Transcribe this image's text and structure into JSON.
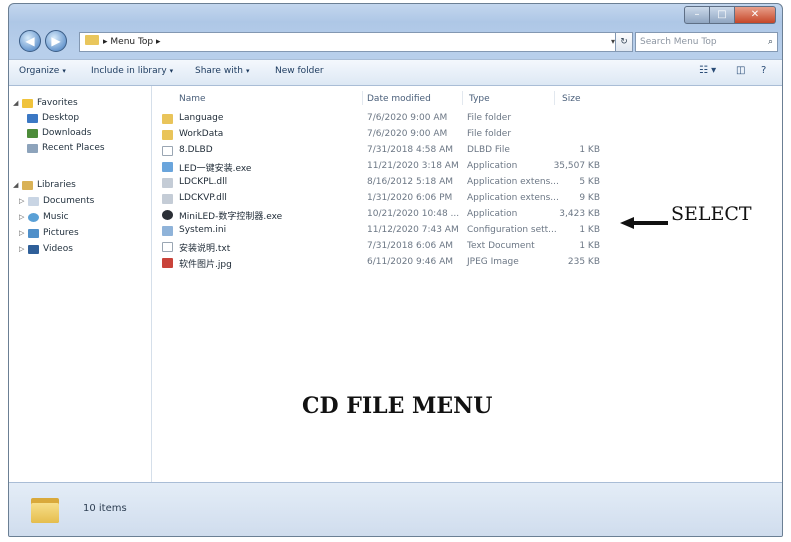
{
  "window": {
    "caption_buttons": [
      "minimize",
      "maximize",
      "close"
    ],
    "address_path": "Menu Top",
    "search_placeholder": "Search Menu Top"
  },
  "toolbar": {
    "organize": "Organize",
    "include_in_library": "Include in library",
    "share_with": "Share with",
    "new_folder": "New folder"
  },
  "navigation": {
    "favorites": "Favorites",
    "desktop": "Desktop",
    "downloads": "Downloads",
    "recent_places": "Recent Places",
    "libraries": "Libraries",
    "documents": "Documents",
    "music": "Music",
    "pictures": "Pictures",
    "videos": "Videos"
  },
  "columns": {
    "name": "Name",
    "date_modified": "Date modified",
    "type": "Type",
    "size": "Size"
  },
  "files": [
    {
      "name": "Language",
      "date": "7/6/2020 9:00 AM",
      "type": "File folder",
      "size": "",
      "icon": "folder-icon"
    },
    {
      "name": "WorkData",
      "date": "7/6/2020 9:00 AM",
      "type": "File folder",
      "size": "",
      "icon": "folder-icon"
    },
    {
      "name": "8.DLBD",
      "date": "7/31/2018 4:58 AM",
      "type": "DLBD File",
      "size": "1 KB",
      "icon": "file-icon"
    },
    {
      "name": "LED一键安装.exe",
      "date": "11/21/2020 3:18 AM",
      "type": "Application",
      "size": "35,507 KB",
      "icon": "installer-icon"
    },
    {
      "name": "LDCKPL.dll",
      "date": "8/16/2012 5:18 AM",
      "type": "Application extens...",
      "size": "5 KB",
      "icon": "dll-icon"
    },
    {
      "name": "LDCKVP.dll",
      "date": "1/31/2020 6:06 PM",
      "type": "Application extens...",
      "size": "9 KB",
      "icon": "dll-icon"
    },
    {
      "name": "MiniLED-数字控制器.exe",
      "date": "10/21/2020 10:48 ...",
      "type": "Application",
      "size": "3,423 KB",
      "icon": "app-icon"
    },
    {
      "name": "System.ini",
      "date": "11/12/2020 7:43 AM",
      "type": "Configuration sett...",
      "size": "1 KB",
      "icon": "config-icon"
    },
    {
      "name": "安装说明.txt",
      "date": "7/31/2018 6:06 AM",
      "type": "Text Document",
      "size": "1 KB",
      "icon": "text-icon"
    },
    {
      "name": "软件图片.jpg",
      "date": "6/11/2020 9:46 AM",
      "type": "JPEG Image",
      "size": "235 KB",
      "icon": "image-icon"
    }
  ],
  "annotations": {
    "select": "SELECT",
    "title": "CD FILE MENU"
  },
  "details": {
    "item_count": "10 items"
  }
}
